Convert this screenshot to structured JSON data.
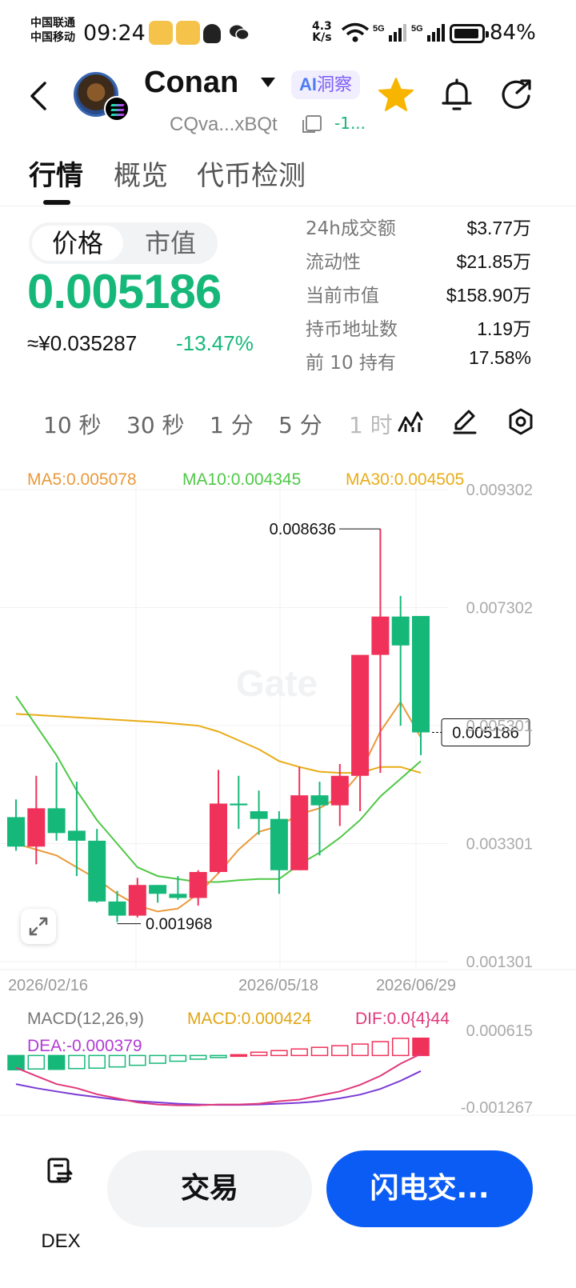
{
  "status_bar": {
    "carrier_1": "中国联通",
    "carrier_2": "中国移动",
    "time": "09:24",
    "net_speed_value": "4.3",
    "net_speed_unit": "K/s",
    "signal_1": "5G",
    "signal_2": "5G",
    "battery": "84%",
    "battery_level": 0.84
  },
  "header": {
    "token_name": "Conan",
    "ai_badge": "洞察",
    "ai_badge_prefix": "AI",
    "address": "CQva...xBQt",
    "address_change": "-1..."
  },
  "tabs": [
    "行情",
    "概览",
    "代币检测"
  ],
  "price_panel": {
    "segments": [
      "价格",
      "市值"
    ],
    "price": "0.005186",
    "price_cny": "≈¥0.035287",
    "change": "-13.47%",
    "stats": [
      {
        "label": "24h成交额",
        "value": "$3.77万"
      },
      {
        "label": "流动性",
        "value": "$21.85万"
      },
      {
        "label": "当前市值",
        "value": "$158.90万"
      },
      {
        "label": "持币地址数",
        "value": "1.19万"
      },
      {
        "label": "前 10 持有",
        "value": "17.58%"
      }
    ]
  },
  "intervals": [
    "10 秒",
    "30 秒",
    "1 分",
    "5 分",
    "1 时"
  ],
  "chart_data": {
    "type": "candlestick",
    "ma_legend": {
      "ma5": "MA5:0.005078",
      "ma10": "MA10:0.004345",
      "ma30": "MA30:0.004505"
    },
    "y_ticks": [
      "0.009302",
      "0.007302",
      "0.005301",
      "0.003301",
      "0.001301"
    ],
    "ylim": [
      0.001301,
      0.009302
    ],
    "x_ticks": [
      "2026/02/16",
      "2026/05/18",
      "2026/06/29"
    ],
    "high_label": "0.008636",
    "low_label": "0.001968",
    "last_price_label": "0.005186",
    "candles": [
      {
        "o": 0.00375,
        "h": 0.00405,
        "l": 0.00318,
        "c": 0.00325
      },
      {
        "o": 0.00325,
        "h": 0.00445,
        "l": 0.00295,
        "c": 0.0039
      },
      {
        "o": 0.0039,
        "h": 0.00468,
        "l": 0.00335,
        "c": 0.00348
      },
      {
        "o": 0.00352,
        "h": 0.00435,
        "l": 0.00275,
        "c": 0.00335
      },
      {
        "o": 0.00335,
        "h": 0.00355,
        "l": 0.0023,
        "c": 0.00232
      },
      {
        "o": 0.00232,
        "h": 0.0025,
        "l": 0.00197,
        "c": 0.00208
      },
      {
        "o": 0.00208,
        "h": 0.00272,
        "l": 0.00205,
        "c": 0.0026
      },
      {
        "o": 0.0026,
        "h": 0.0026,
        "l": 0.0023,
        "c": 0.00245
      },
      {
        "o": 0.00245,
        "h": 0.00275,
        "l": 0.00235,
        "c": 0.00238
      },
      {
        "o": 0.00238,
        "h": 0.00285,
        "l": 0.00225,
        "c": 0.00282
      },
      {
        "o": 0.00282,
        "h": 0.00455,
        "l": 0.0028,
        "c": 0.00398
      },
      {
        "o": 0.00398,
        "h": 0.00445,
        "l": 0.00355,
        "c": 0.00395
      },
      {
        "o": 0.00385,
        "h": 0.0042,
        "l": 0.00345,
        "c": 0.00372
      },
      {
        "o": 0.00372,
        "h": 0.00385,
        "l": 0.00245,
        "c": 0.00285
      },
      {
        "o": 0.00285,
        "h": 0.0046,
        "l": 0.00285,
        "c": 0.00412
      },
      {
        "o": 0.00412,
        "h": 0.00435,
        "l": 0.0031,
        "c": 0.00395
      },
      {
        "o": 0.00395,
        "h": 0.00465,
        "l": 0.0036,
        "c": 0.00445
      },
      {
        "o": 0.00445,
        "h": 0.00535,
        "l": 0.00385,
        "c": 0.0065
      },
      {
        "o": 0.0065,
        "h": 0.008636,
        "l": 0.0045,
        "c": 0.00715
      },
      {
        "o": 0.00715,
        "h": 0.0075,
        "l": 0.0053,
        "c": 0.00666
      },
      {
        "o": 0.00716,
        "h": 0.00716,
        "l": 0.0048,
        "c": 0.005186
      }
    ],
    "ma5": [
      0.0033,
      0.0032,
      0.0031,
      0.0029,
      0.0027,
      0.00245,
      0.00225,
      0.00215,
      0.0022,
      0.00245,
      0.0028,
      0.0032,
      0.0035,
      0.0036,
      0.0038,
      0.0039,
      0.0041,
      0.0045,
      0.0052,
      0.0057,
      0.0051
    ],
    "ma10": [
      0.0058,
      0.0053,
      0.0048,
      0.0042,
      0.0037,
      0.0033,
      0.0029,
      0.00275,
      0.0027,
      0.00265,
      0.00265,
      0.00268,
      0.0027,
      0.0027,
      0.00295,
      0.00315,
      0.0034,
      0.0037,
      0.0041,
      0.0044,
      0.0047
    ],
    "ma30": [
      0.0055,
      0.00548,
      0.00546,
      0.00544,
      0.00542,
      0.0054,
      0.00538,
      0.00536,
      0.00533,
      0.0053,
      0.0052,
      0.00505,
      0.0049,
      0.0047,
      0.0046,
      0.00452,
      0.0045,
      0.0045,
      0.0046,
      0.0046,
      0.0045
    ],
    "macd_legend": {
      "title": "MACD(12,26,9)",
      "macd": "MACD:0.000424",
      "dif": "DIF:0.0{4}44",
      "dea": "DEA:-0.000379"
    },
    "macd_y_ticks": [
      "0.000615",
      "-0.001267"
    ],
    "macd_ylim": [
      -0.001267,
      0.000615
    ],
    "macd_hist": [
      -0.00035,
      -0.00033,
      -0.00034,
      -0.00032,
      -0.00031,
      -0.00028,
      -0.00024,
      -0.00019,
      -0.00014,
      -9e-05,
      -5e-05,
      2e-05,
      8e-05,
      0.00012,
      0.00016,
      0.0002,
      0.00024,
      0.00028,
      0.00034,
      0.00042,
      0.000424
    ],
    "dif": [
      -0.0003,
      -0.0005,
      -0.0007,
      -0.0008,
      -0.00095,
      -0.00105,
      -0.00115,
      -0.0012,
      -0.00122,
      -0.00122,
      -0.0012,
      -0.0012,
      -0.00118,
      -0.00112,
      -0.00108,
      -0.00098,
      -0.00088,
      -0.00072,
      -0.0005,
      -0.0002,
      4e-05
    ],
    "dea": [
      -0.0007,
      -0.0008,
      -0.00088,
      -0.00096,
      -0.00102,
      -0.00108,
      -0.00112,
      -0.00115,
      -0.00118,
      -0.0012,
      -0.00121,
      -0.00121,
      -0.0012,
      -0.00118,
      -0.00116,
      -0.00112,
      -0.00105,
      -0.00096,
      -0.00082,
      -0.00062,
      -0.00038
    ]
  },
  "bottom_bar": {
    "dex_label": "DEX",
    "trade_label": "交易",
    "flash_label": "闪电交..."
  }
}
